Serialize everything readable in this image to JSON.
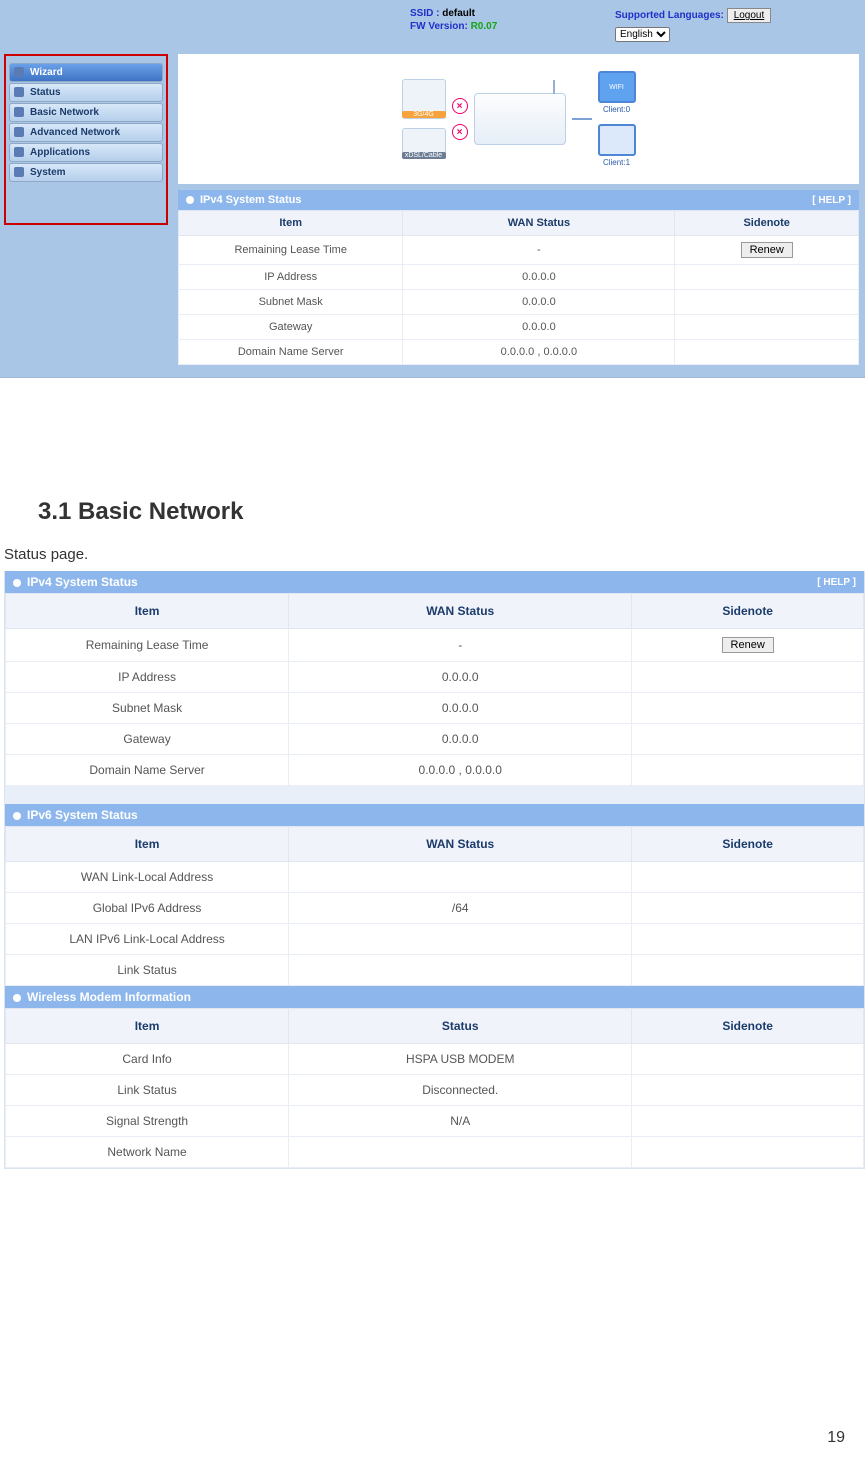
{
  "header": {
    "ssid_label": "SSID :",
    "ssid_value": "default",
    "fw_label": "FW Version:",
    "fw_value": "R0.07",
    "supported_lang_label": "Supported Languages:",
    "logout": "Logout",
    "language": "English"
  },
  "sidebar": {
    "items": [
      {
        "label": "Wizard"
      },
      {
        "label": "Status"
      },
      {
        "label": "Basic Network"
      },
      {
        "label": "Advanced Network"
      },
      {
        "label": "Applications"
      },
      {
        "label": "System"
      }
    ]
  },
  "topo": {
    "client0": "Client:0",
    "client1": "Client:1",
    "wifi": "WIFI",
    "dongle": "3G/4G",
    "cable": "xDSL/Cable"
  },
  "panel_small": {
    "title": "IPv4 System Status",
    "help": "[ HELP ]",
    "headers": {
      "item": "Item",
      "wan": "WAN Status",
      "side": "Sidenote"
    },
    "rows": [
      {
        "item": "Remaining Lease Time",
        "wan": "-",
        "side_btn": "Renew"
      },
      {
        "item": "IP Address",
        "wan": "0.0.0.0",
        "side": ""
      },
      {
        "item": "Subnet Mask",
        "wan": "0.0.0.0",
        "side": ""
      },
      {
        "item": "Gateway",
        "wan": "0.0.0.0",
        "side": ""
      },
      {
        "item": "Domain Name Server",
        "wan": "0.0.0.0 , 0.0.0.0",
        "side": ""
      }
    ]
  },
  "doc": {
    "heading": "3.1   Basic Network",
    "subtitle": "Status page.",
    "page_number": "19",
    "ipv4": {
      "title": "IPv4 System Status",
      "help": "[ HELP ]",
      "headers": {
        "item": "Item",
        "wan": "WAN Status",
        "side": "Sidenote"
      },
      "rows": [
        {
          "item": "Remaining Lease Time",
          "wan": "-",
          "side_btn": "Renew"
        },
        {
          "item": "IP Address",
          "wan": "0.0.0.0",
          "side": ""
        },
        {
          "item": "Subnet Mask",
          "wan": "0.0.0.0",
          "side": ""
        },
        {
          "item": "Gateway",
          "wan": "0.0.0.0",
          "side": ""
        },
        {
          "item": "Domain Name Server",
          "wan": "0.0.0.0 , 0.0.0.0",
          "side": ""
        }
      ]
    },
    "ipv6": {
      "title": "IPv6 System Status",
      "headers": {
        "item": "Item",
        "wan": "WAN Status",
        "side": "Sidenote"
      },
      "rows": [
        {
          "item": "WAN Link-Local Address",
          "wan": "",
          "side": ""
        },
        {
          "item": "Global IPv6 Address",
          "wan": "/64",
          "side": ""
        },
        {
          "item": "LAN IPv6 Link-Local Address",
          "wan": "",
          "side": ""
        },
        {
          "item": "Link Status",
          "wan": "",
          "side": ""
        }
      ]
    },
    "modem": {
      "title": "Wireless Modem Information",
      "headers": {
        "item": "Item",
        "status": "Status",
        "side": "Sidenote"
      },
      "rows": [
        {
          "item": "Card Info",
          "status": "HSPA USB MODEM",
          "side": ""
        },
        {
          "item": "Link Status",
          "status": "Disconnected.",
          "side": ""
        },
        {
          "item": "Signal Strength",
          "status": "N/A",
          "side": ""
        },
        {
          "item": "Network Name",
          "status": "",
          "side": ""
        }
      ]
    }
  }
}
